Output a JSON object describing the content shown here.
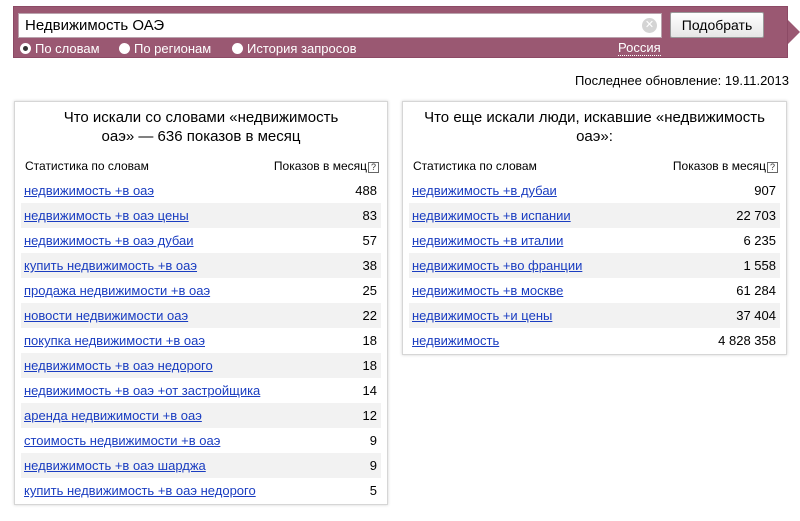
{
  "search": {
    "query": "Недвижимость ОАЭ",
    "submit_label": "Подобрать",
    "modes": [
      {
        "label": "По словам",
        "checked": true
      },
      {
        "label": "По регионам",
        "checked": false
      },
      {
        "label": "История запросов",
        "checked": false
      }
    ],
    "region": "Россия"
  },
  "last_update": "Последнее обновление: 19.11.2013",
  "left_panel": {
    "title": "Что искали со словами «недвижимость оаэ» — 636 показов в месяц",
    "col_phrase": "Статистика по словам",
    "col_count": "Показов в месяц",
    "help": "?",
    "rows": [
      {
        "phrase": "недвижимость +в оаэ",
        "count": "488"
      },
      {
        "phrase": "недвижимость +в оаэ цены",
        "count": "83"
      },
      {
        "phrase": "недвижимость +в оаэ дубаи",
        "count": "57"
      },
      {
        "phrase": "купить недвижимость +в оаэ",
        "count": "38"
      },
      {
        "phrase": "продажа недвижимости +в оаэ",
        "count": "25"
      },
      {
        "phrase": "новости недвижимости оаэ",
        "count": "22"
      },
      {
        "phrase": "покупка недвижимости +в оаэ",
        "count": "18"
      },
      {
        "phrase": "недвижимость +в оаэ недорого",
        "count": "18"
      },
      {
        "phrase": "недвижимость +в оаэ +от застройщика",
        "count": "14"
      },
      {
        "phrase": "аренда недвижимости +в оаэ",
        "count": "12"
      },
      {
        "phrase": "стоимость недвижимости +в оаэ",
        "count": "9"
      },
      {
        "phrase": "недвижимость +в оаэ шарджа",
        "count": "9"
      },
      {
        "phrase": "купить недвижимость +в оаэ недорого",
        "count": "5"
      }
    ]
  },
  "right_panel": {
    "title": "Что еще искали люди, искавшие «недвижимость оаэ»:",
    "col_phrase": "Статистика по словам",
    "col_count": "Показов в месяц",
    "help": "?",
    "rows": [
      {
        "phrase": "недвижимость +в дубаи",
        "count": "907"
      },
      {
        "phrase": "недвижимость +в испании",
        "count": "22 703"
      },
      {
        "phrase": "недвижимость +в италии",
        "count": "6 235"
      },
      {
        "phrase": "недвижимость +во франции",
        "count": "1 558"
      },
      {
        "phrase": "недвижимость +в москве",
        "count": "61 284"
      },
      {
        "phrase": "недвижимость +и цены",
        "count": "37 404"
      },
      {
        "phrase": "недвижимость",
        "count": "4 828 358"
      }
    ]
  }
}
